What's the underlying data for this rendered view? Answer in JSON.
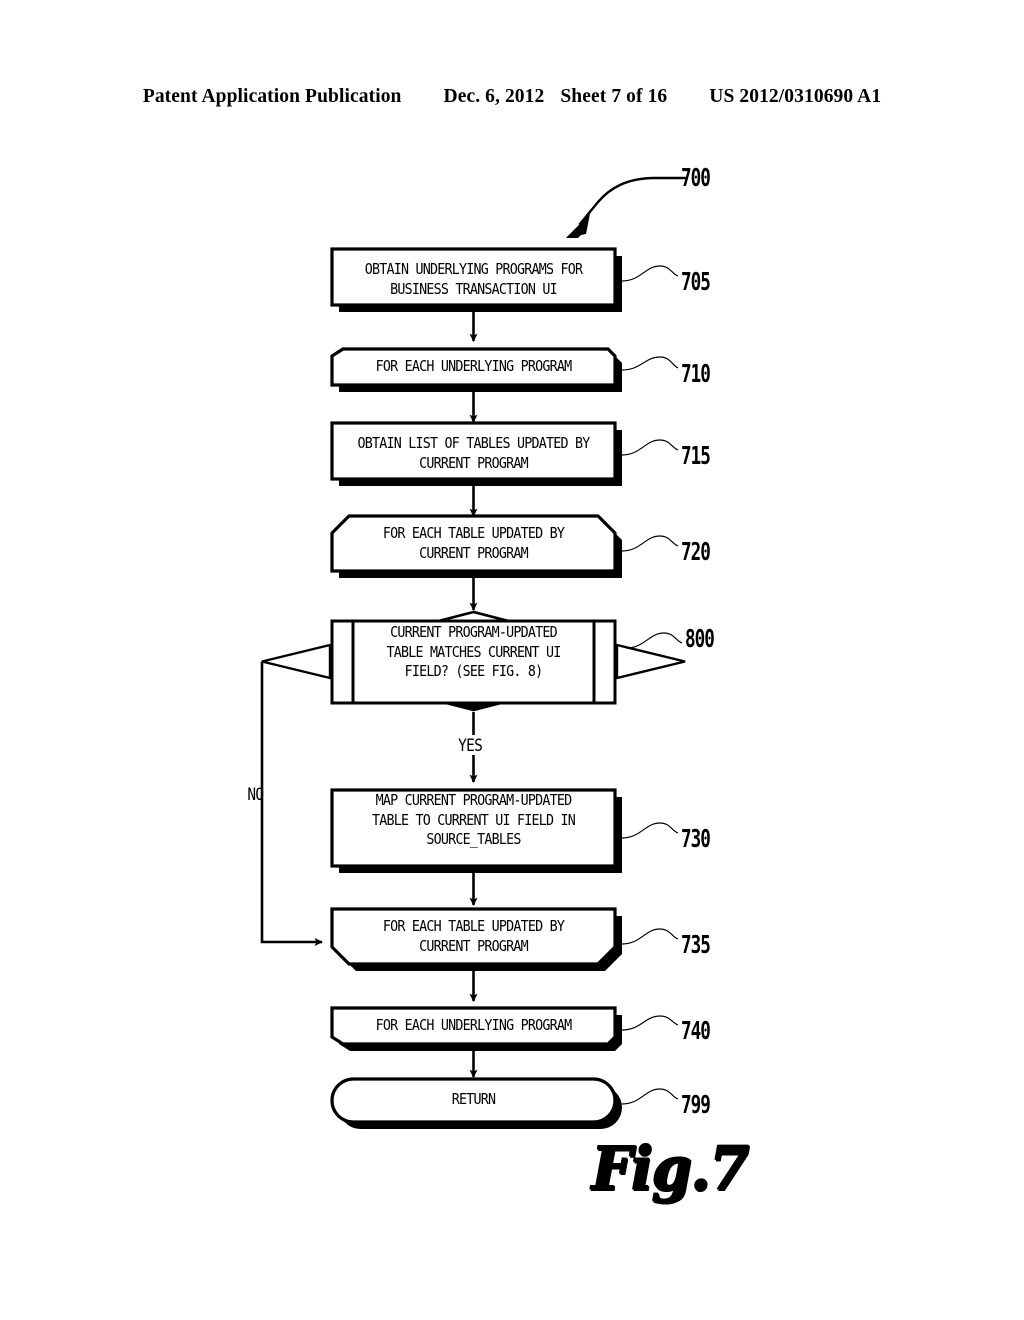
{
  "header": {
    "publication": "Patent Application Publication",
    "date": "Dec. 6, 2012",
    "sheet": "Sheet 7 of 16",
    "doc_number": "US 2012/0310690 A1"
  },
  "figure": {
    "caption": "Fig.7",
    "diagram_ref": "700"
  },
  "branches": {
    "yes": "YES",
    "no": "NO"
  },
  "nodes": [
    {
      "id": "705",
      "ref": "705",
      "shape": "process",
      "text": "OBTAIN UNDERLYING PROGRAMS FOR\nBUSINESS TRANSACTION UI"
    },
    {
      "id": "710",
      "ref": "710",
      "shape": "loop-start",
      "text": "FOR EACH UNDERLYING PROGRAM"
    },
    {
      "id": "715",
      "ref": "715",
      "shape": "process",
      "text": "OBTAIN LIST OF TABLES UPDATED BY\nCURRENT PROGRAM"
    },
    {
      "id": "720",
      "ref": "720",
      "shape": "loop-start",
      "text": "FOR EACH TABLE UPDATED BY\nCURRENT PROGRAM"
    },
    {
      "id": "800",
      "ref": "800",
      "shape": "decision",
      "text": "CURRENT PROGRAM-UPDATED\nTABLE MATCHES CURRENT UI\nFIELD? (SEE FIG. 8)"
    },
    {
      "id": "730",
      "ref": "730",
      "shape": "process",
      "text": "MAP CURRENT PROGRAM-UPDATED\nTABLE TO CURRENT UI FIELD IN\nSOURCE_TABLES"
    },
    {
      "id": "735",
      "ref": "735",
      "shape": "loop-end",
      "text": "FOR EACH TABLE UPDATED BY\nCURRENT PROGRAM"
    },
    {
      "id": "740",
      "ref": "740",
      "shape": "loop-end",
      "text": "FOR EACH UNDERLYING PROGRAM"
    },
    {
      "id": "799",
      "ref": "799",
      "shape": "terminator",
      "text": "RETURN"
    }
  ],
  "colors": {
    "ink": "#000000",
    "paper": "#ffffff"
  }
}
